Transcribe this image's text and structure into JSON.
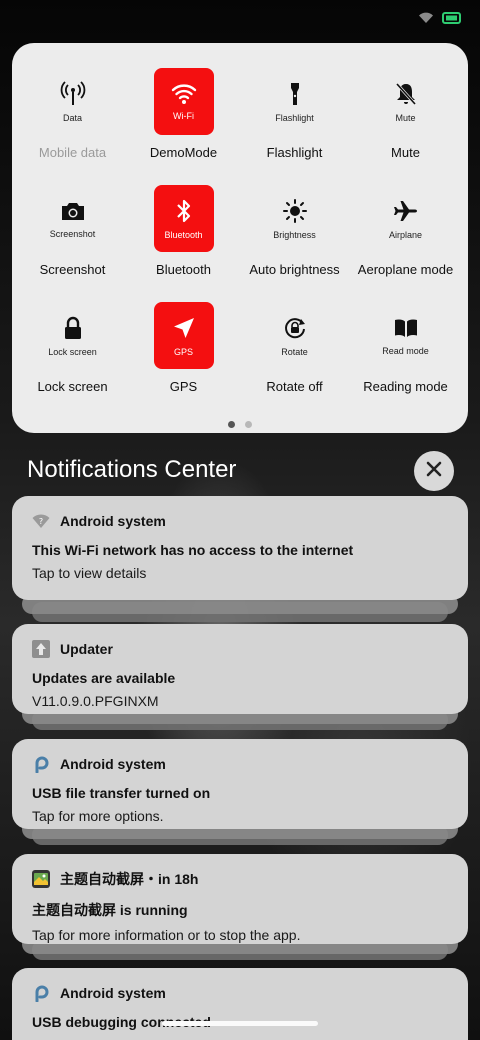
{
  "quick_settings": {
    "tiles": [
      {
        "label": "Data",
        "caption": "Mobile data",
        "icon": "antenna-icon",
        "active": false,
        "caption_muted": true
      },
      {
        "label": "Wi-Fi",
        "caption": "DemoMode",
        "icon": "wifi-icon",
        "active": true,
        "caption_muted": false
      },
      {
        "label": "Flashlight",
        "caption": "Flashlight",
        "icon": "flashlight-icon",
        "active": false,
        "caption_muted": false
      },
      {
        "label": "Mute",
        "caption": "Mute",
        "icon": "bell-off-icon",
        "active": false,
        "caption_muted": false
      },
      {
        "label": "Screenshot",
        "caption": "Screenshot",
        "icon": "camera-icon",
        "active": false,
        "caption_muted": false
      },
      {
        "label": "Bluetooth",
        "caption": "Bluetooth",
        "icon": "bluetooth-icon",
        "active": true,
        "caption_muted": false
      },
      {
        "label": "Brightness",
        "caption": "Auto brightness",
        "icon": "sun-icon",
        "active": false,
        "caption_muted": false
      },
      {
        "label": "Airplane",
        "caption": "Aeroplane mode",
        "icon": "airplane-icon",
        "active": false,
        "caption_muted": false
      },
      {
        "label": "Lock screen",
        "caption": "Lock screen",
        "icon": "lock-icon",
        "active": false,
        "caption_muted": false
      },
      {
        "label": "GPS",
        "caption": "GPS",
        "icon": "location-arrow-icon",
        "active": true,
        "caption_muted": false
      },
      {
        "label": "Rotate",
        "caption": "Rotate off",
        "icon": "rotate-lock-icon",
        "active": false,
        "caption_muted": false
      },
      {
        "label": "Read mode",
        "caption": "Reading mode",
        "icon": "book-icon",
        "active": false,
        "caption_muted": false
      }
    ],
    "page_count": 2,
    "current_page": 1
  },
  "notifications_center": {
    "title": "Notifications Center",
    "items": [
      {
        "app": "Android system",
        "app_icon": "wifi-question-icon",
        "title": "This Wi-Fi network has no access to the internet",
        "body": "Tap to view details"
      },
      {
        "app": "Updater",
        "app_icon": "update-arrow-icon",
        "title": "Updates are available",
        "body": "V11.0.9.0.PFGINXM"
      },
      {
        "app": "Android system",
        "app_icon": "usb-p-icon",
        "title": "USB file transfer turned on",
        "body": "Tap for more options."
      },
      {
        "app": "主题自动截屏・in 18h",
        "app_icon": "app-thumbnail-icon",
        "title": "主题自动截屏 is running",
        "body": "Tap for more information or to stop the app."
      },
      {
        "app": "Android system",
        "app_icon": "usb-p-icon",
        "title": "USB debugging connected",
        "body": ""
      }
    ]
  },
  "colors": {
    "accent": "#f40f10",
    "panel": "#ececec",
    "card": "#d4d4d4",
    "battery": "#2ecc71"
  }
}
